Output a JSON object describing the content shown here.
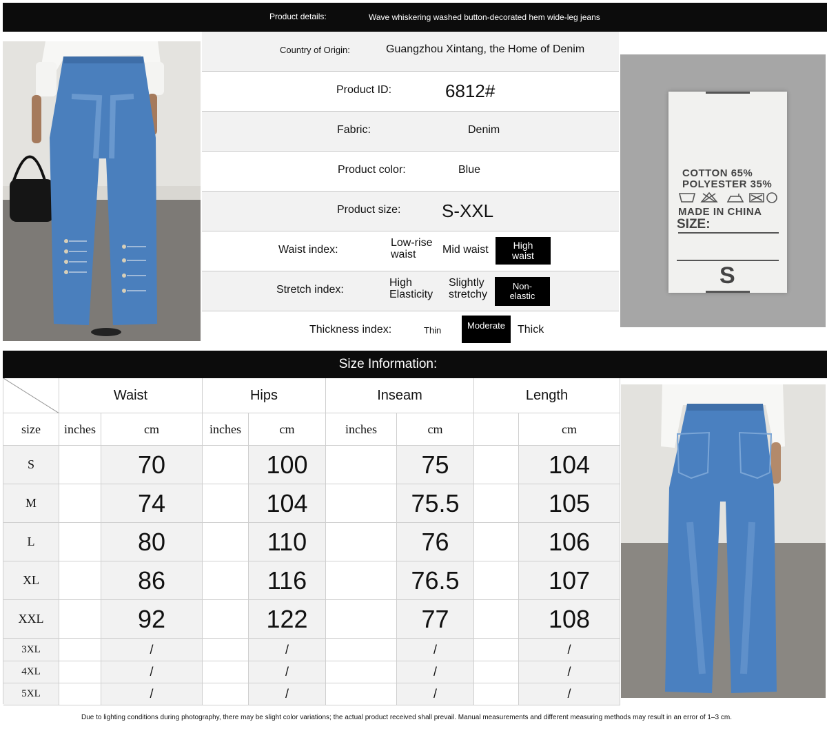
{
  "header": {
    "label": "Product details:",
    "title": "Wave whiskering washed button-decorated hem wide-leg jeans"
  },
  "details": {
    "origin": {
      "label": "Country of Origin:",
      "value": "Guangzhou Xintang, the Home of Denim"
    },
    "product_id": {
      "label": "Product ID:",
      "value": "6812#"
    },
    "fabric": {
      "label": "Fabric:",
      "value": "Denim"
    },
    "color": {
      "label": "Product color:",
      "value": "Blue"
    },
    "size": {
      "label": "Product size:",
      "value": "S-XXL"
    },
    "waist_index": {
      "label": "Waist index:",
      "options": [
        "Low-rise waist",
        "Mid waist",
        "High waist"
      ],
      "selected": "High waist"
    },
    "stretch_index": {
      "label": "Stretch index:",
      "options": [
        "High Elasticity",
        "Slightly stretchy",
        "Non-elastic"
      ],
      "selected": "Non-elastic"
    },
    "thickness_index": {
      "label": "Thickness index:",
      "options": [
        "Thin",
        "Moderate",
        "Thick"
      ],
      "selected": "Moderate"
    }
  },
  "care_label": {
    "line1": "COTTON 65%",
    "line2": "POLYESTER 35%",
    "line3": "MADE IN CHINA",
    "line4": "SIZE:",
    "size": "S"
  },
  "size_info": {
    "title": "Size Information:",
    "groups": [
      "Waist",
      "Hips",
      "Inseam",
      "Length"
    ],
    "size_col": "size",
    "inches": "inches",
    "cm": "cm",
    "rows": [
      {
        "size": "S",
        "waist": "70",
        "hips": "100",
        "inseam": "75",
        "length": "104"
      },
      {
        "size": "M",
        "waist": "74",
        "hips": "104",
        "inseam": "75.5",
        "length": "105"
      },
      {
        "size": "L",
        "waist": "80",
        "hips": "110",
        "inseam": "76",
        "length": "106"
      },
      {
        "size": "XL",
        "waist": "86",
        "hips": "116",
        "inseam": "76.5",
        "length": "107"
      },
      {
        "size": "XXL",
        "waist": "92",
        "hips": "122",
        "inseam": "77",
        "length": "108"
      },
      {
        "size": "3XL",
        "waist": "/",
        "hips": "/",
        "inseam": "/",
        "length": "/"
      },
      {
        "size": "4XL",
        "waist": "/",
        "hips": "/",
        "inseam": "/",
        "length": "/"
      },
      {
        "size": "5XL",
        "waist": "/",
        "hips": "/",
        "inseam": "/",
        "length": "/"
      }
    ]
  },
  "footer": {
    "note": "Due to lighting conditions during photography, there may be slight color variations; the actual product received shall prevail. Manual measurements and different measuring methods may result in an error of 1–3 cm."
  },
  "colors": {
    "bar": "#0c0c0c",
    "denim": "#4a7fbd",
    "cell_grey": "#f2f2f2",
    "tag_black": "#000000"
  }
}
